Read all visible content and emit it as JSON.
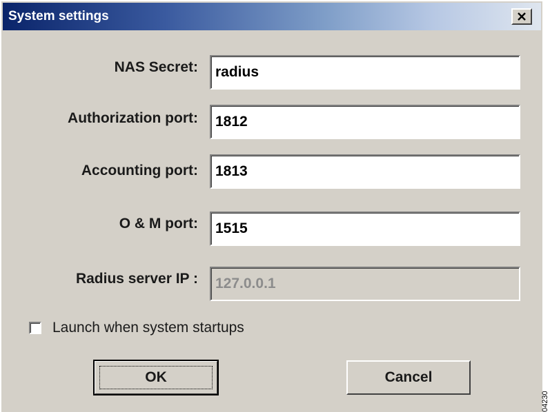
{
  "window": {
    "title": "System settings",
    "close_glyph": "✕"
  },
  "fields": [
    {
      "label": "NAS Secret:",
      "value": "radius",
      "enabled": true
    },
    {
      "label": "Authorization port:",
      "value": "1812",
      "enabled": true
    },
    {
      "label": "Accounting port:",
      "value": "1813",
      "enabled": true
    },
    {
      "label": "O & M port:",
      "value": "1515",
      "enabled": true
    },
    {
      "label": "Radius server IP :",
      "value": "127.0.0.1",
      "enabled": false
    }
  ],
  "checkbox": {
    "label": "Launch when system startups",
    "checked": false
  },
  "buttons": {
    "ok": "OK",
    "cancel": "Cancel"
  },
  "side_code": "04230",
  "icons": {
    "close": "close-icon"
  }
}
